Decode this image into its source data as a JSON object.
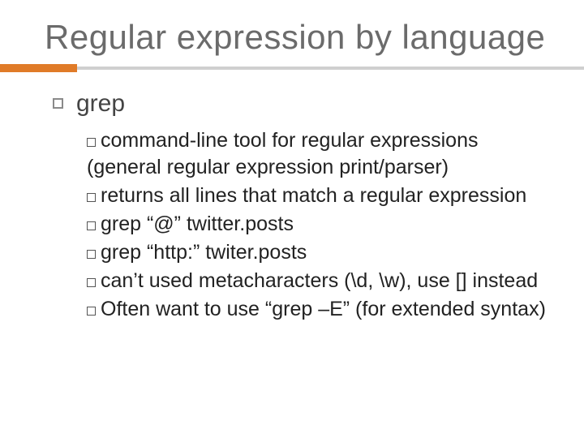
{
  "title": "Regular expression by language",
  "item1": {
    "label": "grep",
    "sub": [
      "command-line tool for regular expressions (general regular expression print/parser)",
      "returns all lines that match a regular expression",
      "grep “@” twitter.posts",
      "grep “http:” twiter.posts",
      "can’t used metacharacters (\\d, \\w), use [] instead",
      "Often want to use “grep –E” (for extended syntax)"
    ]
  }
}
